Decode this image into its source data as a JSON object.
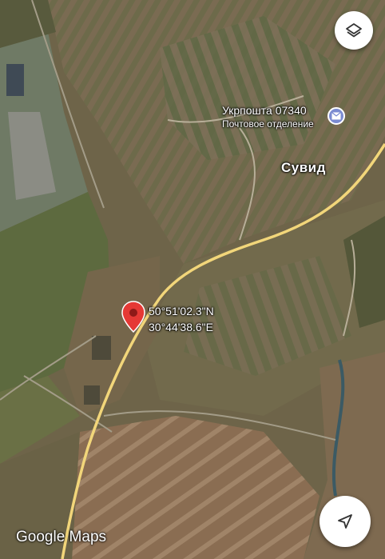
{
  "map": {
    "poi": {
      "name": "Укрпошта 07340",
      "subtitle": "Почтовое отделение",
      "icon": "mail-icon",
      "icon_color": "#7b8bd1"
    },
    "place_label": "Сувид",
    "pin": {
      "icon": "location-pin-icon",
      "color": "#e53935",
      "latitude": "50°51'02.3\"N",
      "longitude": "30°44'38.6\"E"
    },
    "road_color": "#f2d67a"
  },
  "controls": {
    "layers_icon": "layers-icon",
    "navigate_icon": "navigation-arrow-icon"
  },
  "branding": {
    "logo_text": "Google Maps"
  }
}
